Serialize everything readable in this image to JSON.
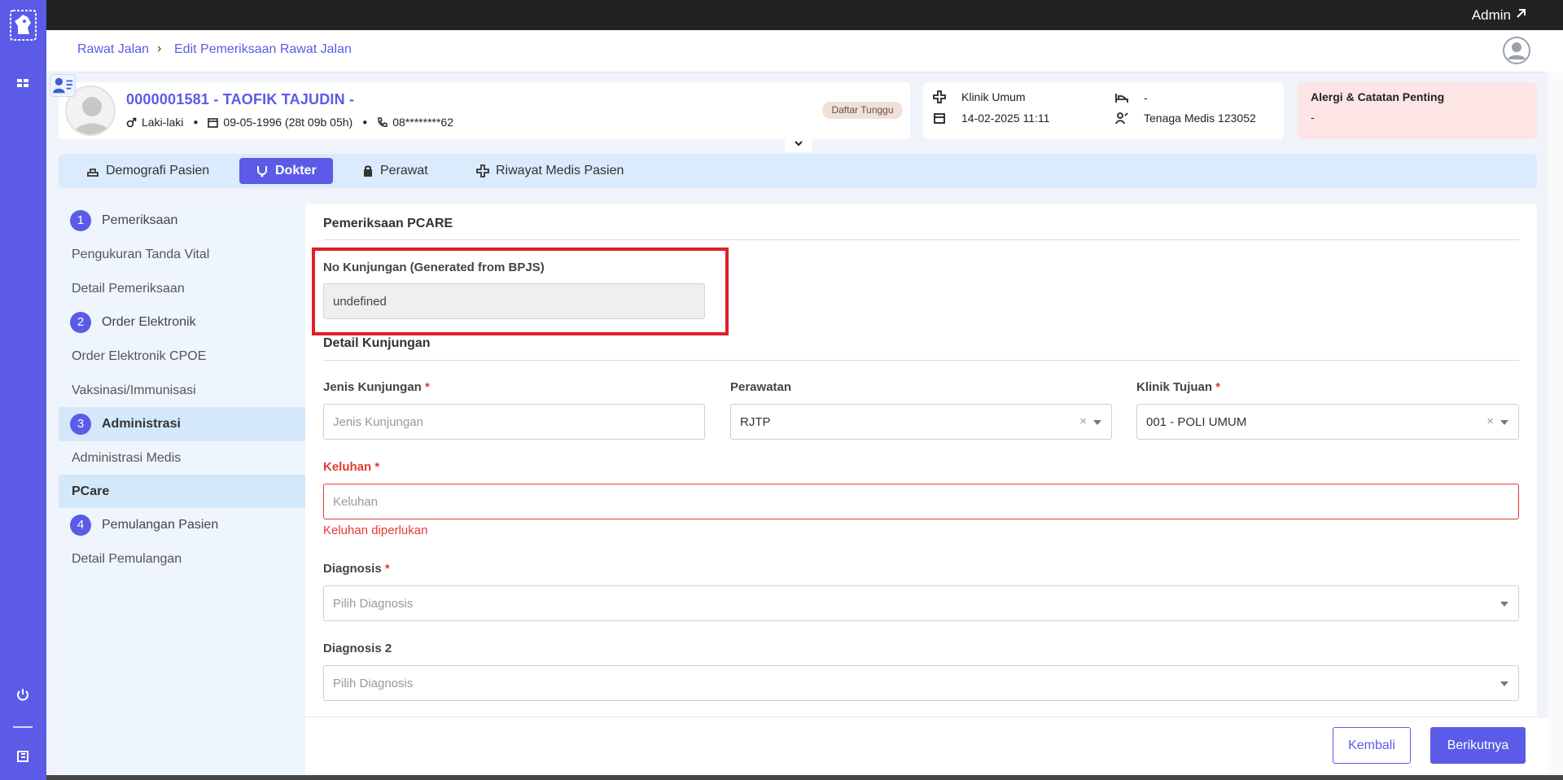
{
  "topbar": {
    "user": "Admin",
    "external_icon": "external-link-icon"
  },
  "breadcrumb": {
    "parent": "Rawat Jalan",
    "separator": "›",
    "current": "Edit Pemeriksaan Rawat Jalan"
  },
  "patient": {
    "title": "0000001581 - TAOFIK TAJUDIN -",
    "gender": "Laki-laki",
    "dob": "09-05-1996 (28t 09b 05h)",
    "phone": "08********62",
    "status_badge": "Daftar Tunggu"
  },
  "visit": {
    "clinic": "Klinik Umum",
    "room": "-",
    "datetime": "14-02-2025 11:11",
    "staff": "Tenaga Medis 123052"
  },
  "allergy": {
    "title": "Alergi & Catatan Penting",
    "value": "-"
  },
  "tabs": [
    {
      "label": "Demografi Pasien",
      "icon": "bed-icon"
    },
    {
      "label": "Dokter",
      "icon": "doctor-icon"
    },
    {
      "label": "Perawat",
      "icon": "nurse-icon"
    },
    {
      "label": "Riwayat Medis Pasien",
      "icon": "medical-cross-icon"
    }
  ],
  "steps": {
    "s1": {
      "num": "1",
      "label": "Pemeriksaan"
    },
    "s1a": "Pengukuran Tanda Vital",
    "s1b": "Detail Pemeriksaan",
    "s2": {
      "num": "2",
      "label": "Order Elektronik"
    },
    "s2a": "Order Elektronik CPOE",
    "s2b": "Vaksinasi/Immunisasi",
    "s3": {
      "num": "3",
      "label": "Administrasi"
    },
    "s3a": "Administrasi Medis",
    "s3b": "PCare",
    "s4": {
      "num": "4",
      "label": "Pemulangan Pasien"
    },
    "s4a": "Detail Pemulangan"
  },
  "form": {
    "section1_title": "Pemeriksaan PCARE",
    "no_kunjungan_label": "No Kunjungan (Generated from BPJS)",
    "no_kunjungan_value": "undefined",
    "section2_title": "Detail Kunjungan",
    "jenis_label": "Jenis Kunjungan",
    "jenis_placeholder": "Jenis Kunjungan",
    "perawatan_label": "Perawatan",
    "perawatan_value": "RJTP",
    "klinik_label": "Klinik Tujuan",
    "klinik_value": "001 - POLI UMUM",
    "keluhan_label": "Keluhan",
    "keluhan_placeholder": "Keluhan",
    "keluhan_error": "Keluhan diperlukan",
    "diagnosis_label": "Diagnosis",
    "diagnosis_placeholder": "Pilih Diagnosis",
    "diagnosis2_label": "Diagnosis 2",
    "diagnosis2_placeholder": "Pilih Diagnosis",
    "required_mark": "*",
    "clear_mark": "×"
  },
  "footer": {
    "back": "Kembali",
    "next": "Berikutnya"
  },
  "colors": {
    "primary": "#5b5be8",
    "error": "#e53935",
    "highlight": "#e01e2a",
    "allergy_bg": "#fde5e5"
  }
}
